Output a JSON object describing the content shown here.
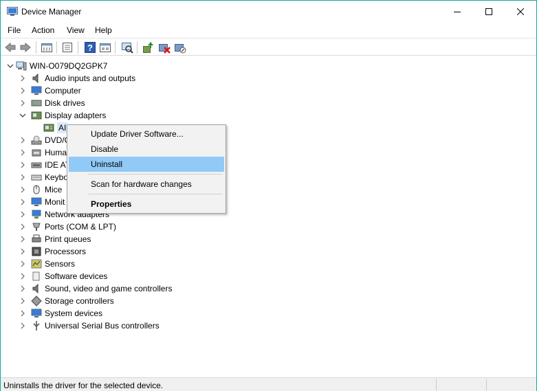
{
  "window": {
    "title": "Device Manager"
  },
  "menu": [
    "File",
    "Action",
    "View",
    "Help"
  ],
  "toolbar": {
    "buttons": [
      "back-icon",
      "forward-icon",
      "properties-sheet-icon",
      "console-tree-icon",
      "help-icon",
      "show-hide-icon",
      "scan-hardware-icon",
      "update-driver-icon",
      "uninstall-device-icon",
      "disable-device-icon"
    ]
  },
  "tree": {
    "root": "WIN-O079DQ2GPK7",
    "categories": [
      {
        "label": "Audio inputs and outputs",
        "icon": "speaker-icon"
      },
      {
        "label": "Computer",
        "icon": "computer-icon"
      },
      {
        "label": "Disk drives",
        "icon": "disk-drive-icon"
      },
      {
        "label": "Display adapters",
        "icon": "display-adapter-icon",
        "expanded": true
      },
      {
        "label": "DVD/C",
        "icon": "dvd-drive-icon"
      },
      {
        "label": "Huma",
        "icon": "hid-icon"
      },
      {
        "label": "IDE AT",
        "icon": "ide-controller-icon"
      },
      {
        "label": "Keybo",
        "icon": "keyboard-icon"
      },
      {
        "label": "Mice",
        "icon": "mouse-icon"
      },
      {
        "label": "Monit",
        "icon": "monitor-icon"
      },
      {
        "label": "Network adapters",
        "icon": "network-adapter-icon"
      },
      {
        "label": "Ports (COM & LPT)",
        "icon": "port-icon"
      },
      {
        "label": "Print queues",
        "icon": "printer-icon"
      },
      {
        "label": "Processors",
        "icon": "processor-icon"
      },
      {
        "label": "Sensors",
        "icon": "sensor-icon"
      },
      {
        "label": "Software devices",
        "icon": "software-device-icon"
      },
      {
        "label": "Sound, video and game controllers",
        "icon": "sound-controller-icon"
      },
      {
        "label": "Storage controllers",
        "icon": "storage-controller-icon"
      },
      {
        "label": "System devices",
        "icon": "system-device-icon"
      },
      {
        "label": "Universal Serial Bus controllers",
        "icon": "usb-icon"
      }
    ],
    "display_child": "AI"
  },
  "context_menu": {
    "items": [
      "Update Driver Software...",
      "Disable",
      "Uninstall",
      "Scan for hardware changes",
      "Properties"
    ],
    "highlighted": "Uninstall"
  },
  "status": {
    "text": "Uninstalls the driver for the selected device."
  }
}
